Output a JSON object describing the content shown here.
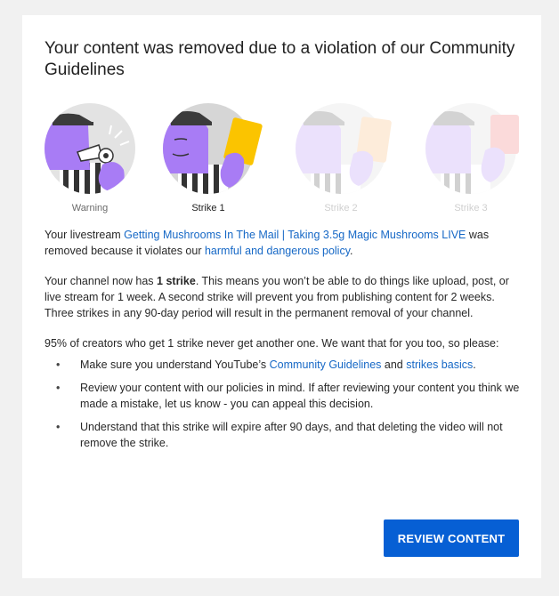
{
  "dialog": {
    "title": "Your content was removed due to a violation of our Community Guidelines",
    "strike_steps": [
      {
        "label": "Warning",
        "state": "muted"
      },
      {
        "label": "Strike 1",
        "state": "active"
      },
      {
        "label": "Strike 2",
        "state": "faded"
      },
      {
        "label": "Strike 3",
        "state": "faded"
      }
    ],
    "body": {
      "p1_pre": "Your livestream ",
      "p1_video_link": "Getting Mushrooms In The Mail | Taking 3.5g Magic Mushrooms LIVE",
      "p1_mid": " was removed because it violates our ",
      "p1_policy_link": "harmful and dangerous policy",
      "p1_end": ".",
      "p2_pre": "Your channel now has ",
      "p2_bold": "1 strike",
      "p2_post": ". This means you won’t be able to do things like upload, post, or live stream for 1 week. A second strike will prevent you from publishing content for 2 weeks. Three strikes in any 90-day period will result in the permanent removal of your channel.",
      "p3": "95% of creators who get 1 strike never get another one. We want that for you too, so please:",
      "tips": {
        "bullet": "•",
        "t1_pre": "Make sure you understand YouTube’s ",
        "t1_link1": "Community Guidelines",
        "t1_mid": " and ",
        "t1_link2": "strikes basics",
        "t1_end": ".",
        "t2": "Review your content with our policies in mind. If after reviewing your content you think we made a mistake, let us know - you can appeal this decision.",
        "t3": "Understand that this strike will expire after 90 days, and that deleting the video will not remove the strike."
      }
    },
    "review_button": "REVIEW CONTENT"
  },
  "colors": {
    "page_bg": "#f1f1f1",
    "card_bg": "#ffffff",
    "link": "#1668c6",
    "button_bg": "#065fd4",
    "illustration_purple": "#a87cf5",
    "illustration_yellow": "#fbc400",
    "illustration_orange": "#f7ab5b",
    "illustration_red": "#ee5a5a"
  }
}
